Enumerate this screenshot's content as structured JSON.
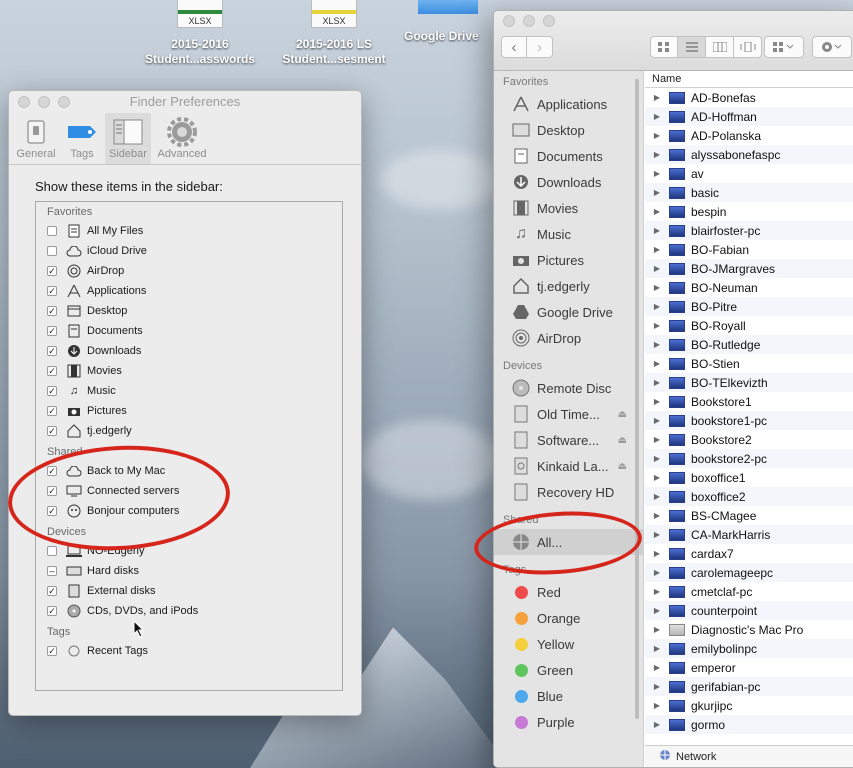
{
  "desktop": {
    "icons": [
      {
        "label": "2015-2016\nStudent...asswords",
        "ext": "XLSX"
      },
      {
        "label": "2015-2016 LS\nStudent...sesment",
        "ext": "XLSX"
      },
      {
        "label": "Google Drive"
      }
    ]
  },
  "prefs": {
    "title": "Finder Preferences",
    "tabs": [
      {
        "label": "General",
        "icon": "switch-icon"
      },
      {
        "label": "Tags",
        "icon": "tag-icon"
      },
      {
        "label": "Sidebar",
        "icon": "sidebar-icon"
      },
      {
        "label": "Advanced",
        "icon": "gear-icon"
      }
    ],
    "active_tab": "Sidebar",
    "heading": "Show these items in the sidebar:",
    "groups": [
      {
        "title": "Favorites",
        "items": [
          {
            "label": "All My Files",
            "checked": false
          },
          {
            "label": "iCloud Drive",
            "checked": false
          },
          {
            "label": "AirDrop",
            "checked": true
          },
          {
            "label": "Applications",
            "checked": true
          },
          {
            "label": "Desktop",
            "checked": true
          },
          {
            "label": "Documents",
            "checked": true
          },
          {
            "label": "Downloads",
            "checked": true
          },
          {
            "label": "Movies",
            "checked": true
          },
          {
            "label": "Music",
            "checked": true
          },
          {
            "label": "Pictures",
            "checked": true
          },
          {
            "label": "tj.edgerly",
            "checked": true
          }
        ]
      },
      {
        "title": "Shared",
        "items": [
          {
            "label": "Back to My Mac",
            "checked": true
          },
          {
            "label": "Connected servers",
            "checked": true
          },
          {
            "label": "Bonjour computers",
            "checked": true
          }
        ]
      },
      {
        "title": "Devices",
        "items": [
          {
            "label": "NO-Edgerly",
            "checked": false
          },
          {
            "label": "Hard disks",
            "checked": "mixed"
          },
          {
            "label": "External disks",
            "checked": true
          },
          {
            "label": "CDs, DVDs, and iPods",
            "checked": true
          }
        ]
      },
      {
        "title": "Tags",
        "items": [
          {
            "label": "Recent Tags",
            "checked": true
          }
        ]
      }
    ]
  },
  "finder": {
    "sidebar": {
      "favorites_title": "Favorites",
      "favorites": [
        "Applications",
        "Desktop",
        "Documents",
        "Downloads",
        "Movies",
        "Music",
        "Pictures",
        "tj.edgerly",
        "Google Drive",
        "AirDrop"
      ],
      "devices_title": "Devices",
      "devices": [
        {
          "label": "Remote Disc",
          "eject": false
        },
        {
          "label": "Old Time...",
          "eject": true
        },
        {
          "label": "Software...",
          "eject": true
        },
        {
          "label": "Kinkaid La...",
          "eject": true
        },
        {
          "label": "Recovery HD",
          "eject": false
        }
      ],
      "shared_title": "Shared",
      "shared": [
        "All..."
      ],
      "tags_title": "Tags",
      "tags": [
        {
          "label": "Red",
          "color": "#f04b4b"
        },
        {
          "label": "Orange",
          "color": "#f6a13b"
        },
        {
          "label": "Yellow",
          "color": "#f5cf3c"
        },
        {
          "label": "Green",
          "color": "#5ec45c"
        },
        {
          "label": "Blue",
          "color": "#4ea8ee"
        },
        {
          "label": "Purple",
          "color": "#c67ad6"
        }
      ]
    },
    "column_header": "Name",
    "items": [
      "AD-Bonefas",
      "AD-Hoffman",
      "AD-Polanska",
      "alyssabonefaspc",
      "av",
      "basic",
      "bespin",
      "blairfoster-pc",
      "BO-Fabian",
      "BO-JMargraves",
      "BO-Neuman",
      "BO-Pitre",
      "BO-Royall",
      "BO-Rutledge",
      "BO-Stien",
      "BO-TElkevizth",
      "Bookstore1",
      "bookstore1-pc",
      "Bookstore2",
      "bookstore2-pc",
      "boxoffice1",
      "boxoffice2",
      "BS-CMagee",
      "CA-MarkHarris",
      "cardax7",
      "carolemageepc",
      "cmetclaf-pc",
      "counterpoint",
      "Diagnostic's Mac Pro",
      "emilybolinpc",
      "emperor",
      "gerifabian-pc",
      "gkurjipc",
      "gormo"
    ],
    "mac_items": [
      "Diagnostic's Mac Pro"
    ],
    "status": "Network"
  }
}
